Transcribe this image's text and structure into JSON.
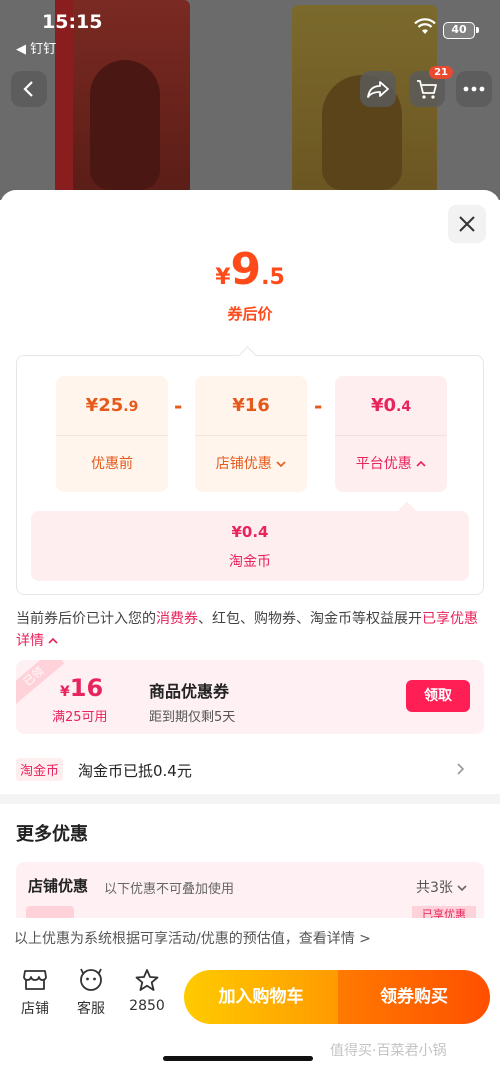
{
  "status_bar": {
    "time": "15:15",
    "back_app": "◀ 钉钉",
    "battery": "40"
  },
  "nav": {
    "cart_badge": "21"
  },
  "sheet": {
    "price": {
      "yen": "¥",
      "int": "9",
      "dec": ".5",
      "label": "券后价"
    },
    "calc": {
      "original": {
        "value_int": "¥25",
        "value_dec": ".9",
        "label": "优惠前"
      },
      "shop": {
        "value": "¥16",
        "label": "店铺优惠"
      },
      "platform": {
        "value_int": "¥0",
        "value_dec": ".4",
        "label": "平台优惠"
      },
      "minus": "-",
      "coin": {
        "value": "¥0.4",
        "label": "淘金币"
      }
    },
    "note": {
      "part1": "当前券后价已计入您的",
      "hl1": "消费券",
      "part2": "、红包、购物券、淘金币等权益展开",
      "hl2": "已享优惠详情"
    },
    "coupon": {
      "ribbon": "已领",
      "yen": "¥",
      "amount": "16",
      "condition": "满25可用",
      "title": "商品优惠券",
      "subtitle": "距到期仅剩5天",
      "button": "领取"
    },
    "coin_row": {
      "tag": "淘金币",
      "text": "淘金币已抵0.4元"
    },
    "more": {
      "title": "更多优惠",
      "shop_title": "店铺优惠",
      "shop_sub": "以下优惠不可叠加使用",
      "shop_count": "共3张",
      "peek_right": "已享优惠"
    },
    "footer_note": "以上优惠为系统根据可享活动/优惠的预估值，查看详情 >"
  },
  "action_bar": {
    "shop": "店铺",
    "service": "客服",
    "fav": "2850",
    "add_cart": "加入购物车",
    "buy": "领券购买",
    "watermark": "值得买·百菜君小锅"
  },
  "colors": {
    "accent": "#ff4a1a",
    "pink": "#e8245d",
    "cart": "#ffb300",
    "buy": "#ff5a00"
  }
}
